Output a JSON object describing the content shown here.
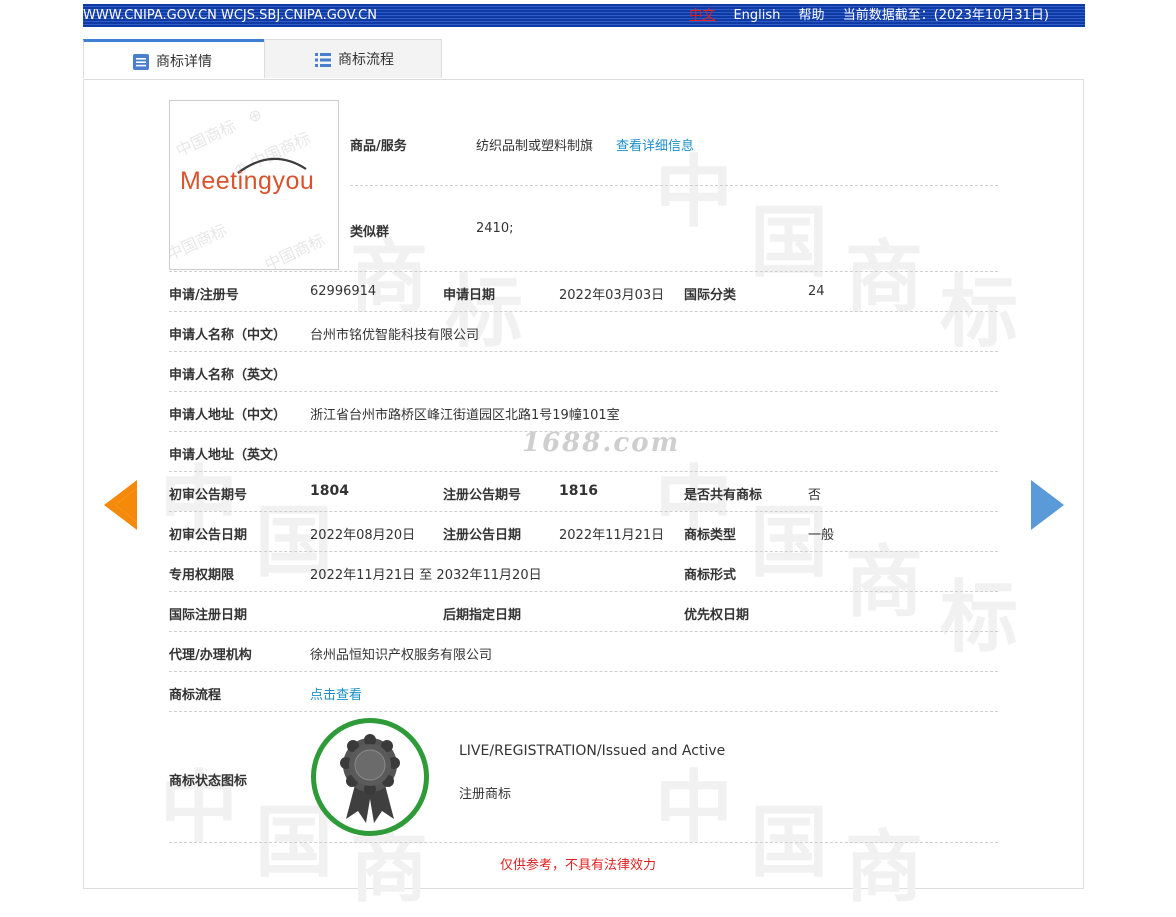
{
  "topbar": {
    "sites": "WWW.CNIPA.GOV.CN WCJS.SBJ.CNIPA.GOV.CN",
    "lang_cn": "中文",
    "lang_en": "English",
    "help": "帮助",
    "data_as_of": "当前数据截至：(2023年10月31日)"
  },
  "tabs": {
    "detail": "商标详情",
    "flow": "商标流程"
  },
  "logo": {
    "text": "Meetingyou"
  },
  "goods": {
    "label": "商品/服务",
    "value": "纺织品制或塑料制旗",
    "link": "查看详细信息"
  },
  "similar_group": {
    "label": "类似群",
    "value": "2410;"
  },
  "rows": {
    "reg_no_label": "申请/注册号",
    "reg_no": "62996914",
    "app_date_label": "申请日期",
    "app_date": "2022年03月03日",
    "intl_class_label": "国际分类",
    "intl_class": "24",
    "applicant_cn_label": "申请人名称（中文）",
    "applicant_cn": "台州市铭优智能科技有限公司",
    "applicant_en_label": "申请人名称（英文）",
    "applicant_en": "",
    "address_cn_label": "申请人地址（中文）",
    "address_cn": "浙江省台州市路桥区峰江街道园区北路1号19幢101室",
    "address_en_label": "申请人地址（英文）",
    "address_en": "",
    "prelim_no_label": "初审公告期号",
    "prelim_no": "1804",
    "reg_pub_no_label": "注册公告期号",
    "reg_pub_no": "1816",
    "shared_label": "是否共有商标",
    "shared": "否",
    "prelim_date_label": "初审公告日期",
    "prelim_date": "2022年08月20日",
    "reg_pub_date_label": "注册公告日期",
    "reg_pub_date": "2022年11月21日",
    "tm_type_label": "商标类型",
    "tm_type": "一般",
    "term_label": "专用权期限",
    "term": "2022年11月21日 至 2032年11月20日",
    "tm_form_label": "商标形式",
    "tm_form": "",
    "intl_reg_date_label": "国际注册日期",
    "intl_reg_date": "",
    "later_date_label": "后期指定日期",
    "later_date": "",
    "priority_date_label": "优先权日期",
    "priority_date": "",
    "agent_label": "代理/办理机构",
    "agent": "徐州品恒知识产权服务有限公司",
    "flow_label": "商标流程",
    "flow_link": "点击查看"
  },
  "status": {
    "label": "商标状态图标",
    "en": "LIVE/REGISTRATION/Issued and Active",
    "cn": "注册商标"
  },
  "watermark": {
    "text": "1688.com"
  },
  "disclaimer": "仅供参考，不具有法律效力",
  "colors": {
    "header": "#0f3aa3",
    "link": "#1a8fc9",
    "badge_ring": "#2e9a38",
    "prev_arrow": "#f58a0a",
    "next_arrow": "#5b9ad9",
    "disclaimer": "#e02020"
  }
}
